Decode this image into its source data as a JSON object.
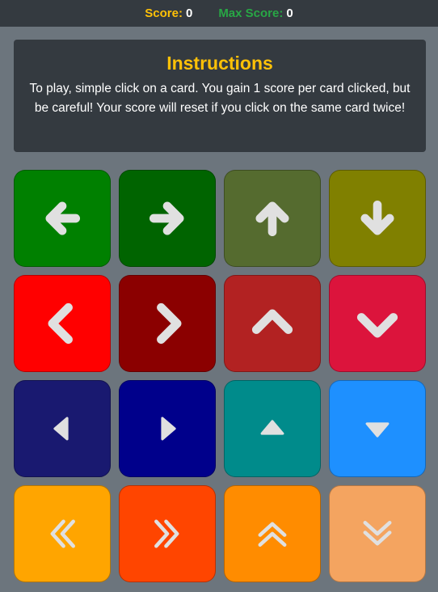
{
  "topbar": {
    "score_label": "Score:",
    "score_value": "0",
    "max_label": "Max Score:",
    "max_value": "0"
  },
  "instructions": {
    "title": "Instructions",
    "text": "To play, simple click on a card. You gain 1 score per card clicked, but be careful! Your score will reset if you click on the same card twice!"
  },
  "icon_color": "#e0e0e0",
  "cards": [
    {
      "color": "#008000",
      "icon": "arrow-left-icon"
    },
    {
      "color": "#006400",
      "icon": "arrow-right-icon"
    },
    {
      "color": "#556b2f",
      "icon": "arrow-up-icon"
    },
    {
      "color": "#808000",
      "icon": "arrow-down-icon"
    },
    {
      "color": "#ff0000",
      "icon": "chevron-left-icon"
    },
    {
      "color": "#8b0000",
      "icon": "chevron-right-icon"
    },
    {
      "color": "#b22222",
      "icon": "chevron-up-icon"
    },
    {
      "color": "#dc143c",
      "icon": "chevron-down-icon"
    },
    {
      "color": "#191970",
      "icon": "caret-left-icon"
    },
    {
      "color": "#00008b",
      "icon": "caret-right-icon"
    },
    {
      "color": "#008b8b",
      "icon": "caret-up-icon"
    },
    {
      "color": "#1e90ff",
      "icon": "caret-down-icon"
    },
    {
      "color": "#ffa500",
      "icon": "double-chevron-left-icon"
    },
    {
      "color": "#ff4500",
      "icon": "double-chevron-right-icon"
    },
    {
      "color": "#ff8c00",
      "icon": "double-chevron-up-icon"
    },
    {
      "color": "#f4a460",
      "icon": "double-chevron-down-icon"
    }
  ]
}
